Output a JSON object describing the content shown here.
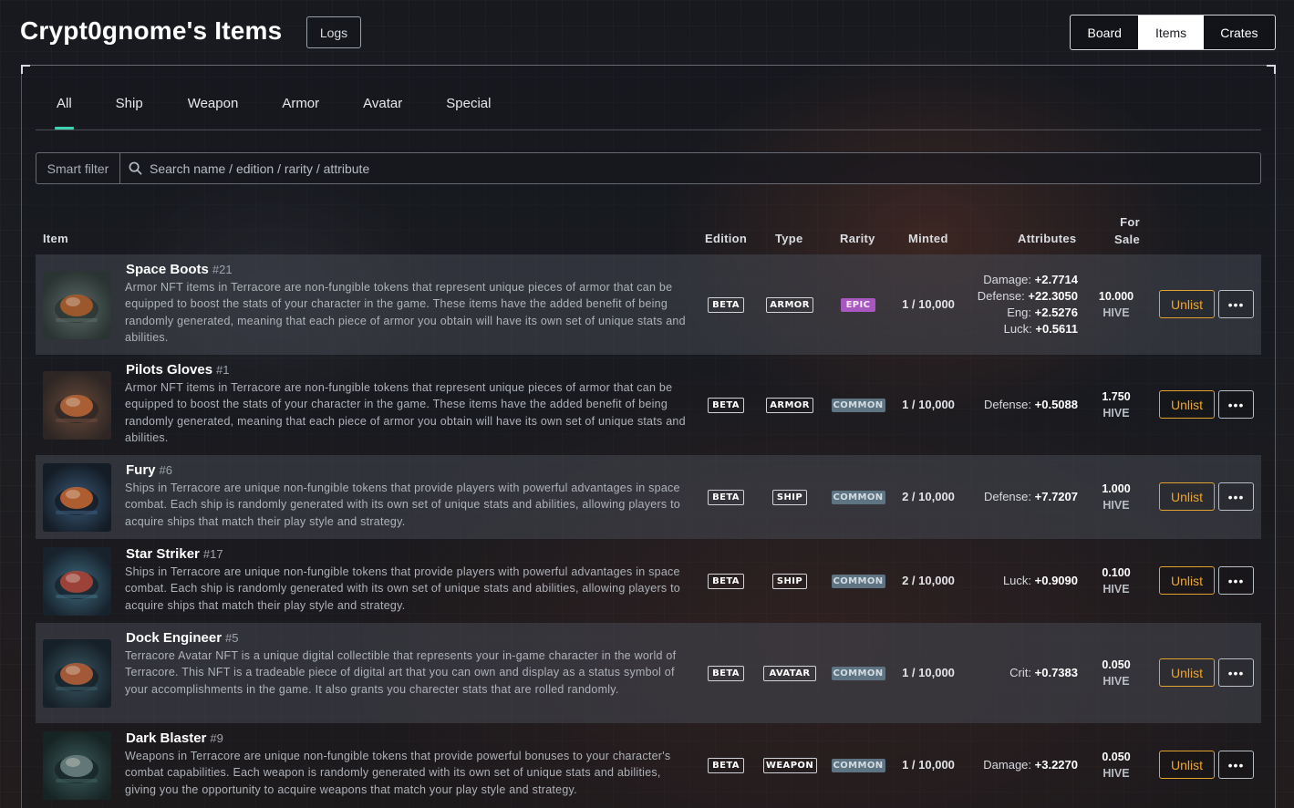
{
  "header": {
    "title": "Crypt0gnome's Items",
    "logs_label": "Logs",
    "view_switch": [
      "Board",
      "Items",
      "Crates"
    ],
    "active_view": "Items"
  },
  "tabs": [
    "All",
    "Ship",
    "Weapon",
    "Armor",
    "Avatar",
    "Special"
  ],
  "active_tab": "All",
  "colors": {
    "accent": "#3fd2b2",
    "unlist": "#efa42a",
    "epic": "#a857c0",
    "common": "#5f7482"
  },
  "search": {
    "smart_filter_label": "Smart filter",
    "placeholder": "Search name / edition / rarity / attribute"
  },
  "columns": {
    "item": "Item",
    "edition": "Edition",
    "type": "Type",
    "rarity": "Rarity",
    "minted": "Minted",
    "attributes": "Attributes",
    "for_sale_1": "For",
    "for_sale_2": "Sale"
  },
  "items": [
    {
      "name": "Space Boots",
      "num": "#21",
      "description": "Armor NFT items in Terracore are non-fungible tokens that represent unique pieces of armor that can be equipped to boost the stats of your character in the game. These items have the added benefit of being randomly generated, meaning that each piece of armor you obtain will have its own set of unique stats and abilities.",
      "edition": "BETA",
      "type": "ARMOR",
      "rarity": "EPIC",
      "minted": "1 / 10,000",
      "attributes": [
        {
          "k": "Damage:",
          "v": "+2.7714"
        },
        {
          "k": "Defense:",
          "v": "+22.3050"
        },
        {
          "k": "Eng:",
          "v": "+2.5276"
        },
        {
          "k": "Luck:",
          "v": "+0.5611"
        }
      ],
      "price": "10.000",
      "currency": "HIVE",
      "unlist_label": "Unlist",
      "more_label": "•••",
      "icon": "boots-icon"
    },
    {
      "name": "Pilots Gloves",
      "num": "#1",
      "description": "Armor NFT items in Terracore are non-fungible tokens that represent unique pieces of armor that can be equipped to boost the stats of your character in the game. These items have the added benefit of being randomly generated, meaning that each piece of armor you obtain will have its own set of unique stats and abilities.",
      "edition": "BETA",
      "type": "ARMOR",
      "rarity": "COMMON",
      "minted": "1 / 10,000",
      "attributes": [
        {
          "k": "Defense:",
          "v": "+0.5088"
        }
      ],
      "price": "1.750",
      "currency": "HIVE",
      "unlist_label": "Unlist",
      "more_label": "•••",
      "icon": "gloves-icon"
    },
    {
      "name": "Fury",
      "num": "#6",
      "description": "Ships in Terracore are unique non-fungible tokens that provide players with powerful advantages in space combat. Each ship is randomly generated with its own set of unique stats and abilities, allowing players to acquire ships that match their play style and strategy.",
      "edition": "BETA",
      "type": "SHIP",
      "rarity": "COMMON",
      "minted": "2 / 10,000",
      "attributes": [
        {
          "k": "Defense:",
          "v": "+7.7207"
        }
      ],
      "price": "1.000",
      "currency": "HIVE",
      "unlist_label": "Unlist",
      "more_label": "•••",
      "icon": "ship-icon"
    },
    {
      "name": "Star Striker",
      "num": "#17",
      "description": "Ships in Terracore are unique non-fungible tokens that provide players with powerful advantages in space combat. Each ship is randomly generated with its own set of unique stats and abilities, allowing players to acquire ships that match their play style and strategy.",
      "edition": "BETA",
      "type": "SHIP",
      "rarity": "COMMON",
      "minted": "2 / 10,000",
      "attributes": [
        {
          "k": "Luck:",
          "v": "+0.9090"
        }
      ],
      "price": "0.100",
      "currency": "HIVE",
      "unlist_label": "Unlist",
      "more_label": "•••",
      "icon": "starfighter-icon"
    },
    {
      "name": "Dock Engineer",
      "num": "#5",
      "description": "Terracore Avatar NFT is a unique digital collectible that represents your in-game character in the world of Terracore. This NFT is a tradeable piece of digital art that you can own and display as a status symbol of your accomplishments in the game. It also grants you charecter stats that are rolled randomly.",
      "edition": "BETA",
      "type": "AVATAR",
      "rarity": "COMMON",
      "minted": "1 / 10,000",
      "attributes": [
        {
          "k": "Crit:",
          "v": "+0.7383"
        }
      ],
      "price": "0.050",
      "currency": "HIVE",
      "unlist_label": "Unlist",
      "more_label": "•••",
      "icon": "engineer-icon"
    },
    {
      "name": "Dark Blaster",
      "num": "#9",
      "description": "Weapons in Terracore are unique non-fungible tokens that provide powerful bonuses to your character's combat capabilities. Each weapon is randomly generated with its own set of unique stats and abilities, giving you the opportunity to acquire weapons that match your play style and strategy.",
      "edition": "BETA",
      "type": "WEAPON",
      "rarity": "COMMON",
      "minted": "1 / 10,000",
      "attributes": [
        {
          "k": "Damage:",
          "v": "+3.2270"
        }
      ],
      "price": "0.050",
      "currency": "HIVE",
      "unlist_label": "Unlist",
      "more_label": "•••",
      "icon": "blaster-icon"
    }
  ]
}
